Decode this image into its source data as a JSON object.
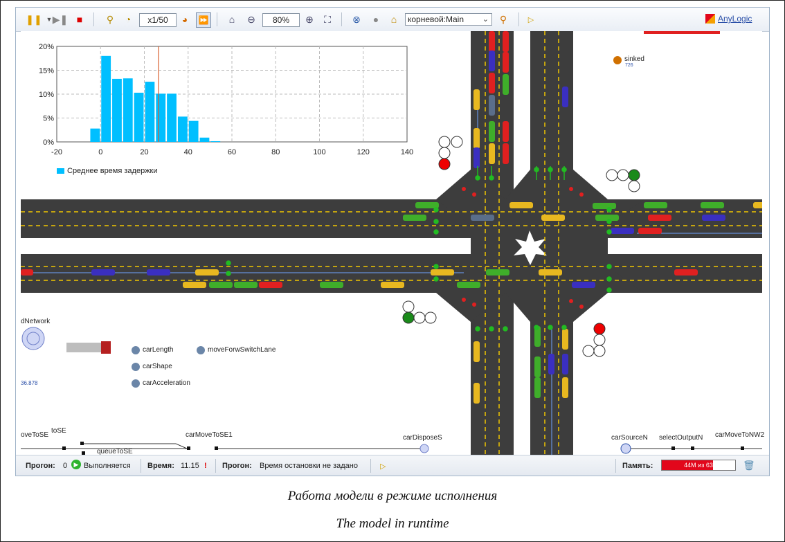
{
  "toolbar": {
    "speed": "x1/50",
    "zoom": "80%",
    "view_select": "корневой:Main",
    "logo": "AnyLogic"
  },
  "chart": {
    "legend": "Среднее время задержки"
  },
  "chart_data": {
    "type": "bar",
    "x": [
      -5,
      5,
      15,
      25,
      35,
      45,
      55,
      65,
      75
    ],
    "values": [
      2.8,
      18,
      13.2,
      13.3,
      10.3,
      12.6,
      10.1,
      10.1,
      5.3,
      4.4,
      0.9,
      0.15
    ],
    "bin_starts": [
      -5,
      0,
      5,
      10,
      15,
      20,
      25,
      30,
      35,
      40,
      45,
      50
    ],
    "xlim": [
      -20,
      140
    ],
    "ylim": [
      0,
      20
    ],
    "xticks": [
      "-20",
      "0",
      "20",
      "40",
      "60",
      "80",
      "100",
      "120",
      "140"
    ],
    "yticks": [
      "0%",
      "5%",
      "10%",
      "15%",
      "20%"
    ],
    "mean_line": 26.5,
    "series_name": "Среднее время задержки",
    "color": "#00bfff",
    "grid": true,
    "legend_position": "bottom-left"
  },
  "labels": {
    "sinked": "sinked",
    "sinked_value": "726",
    "network": "dNetwork",
    "network_value": "36.878",
    "func1": "carLength",
    "func2": "carShape",
    "func3": "carAcceleration",
    "func4": "moveForwSwitchLane",
    "flow1": "oveToSE",
    "flow2": "toSE",
    "flow3": "queueToSE",
    "flow4": "carMoveToSE1",
    "flow5": "carDisposeS",
    "flow6": "carSourceN",
    "flow7": "selectOutputN",
    "flow8": "carMoveToNW2"
  },
  "status": {
    "run_label": "Прогон:",
    "run_value": "0",
    "running": "Выполняется",
    "time_label": "Время:",
    "time_value": "11.15",
    "run2_label": "Прогон:",
    "stop_text": "Время остановки не задано",
    "memory_label": "Память:",
    "memory_value": "44M из 63",
    "memory_fraction": 0.7
  },
  "captions": {
    "ru": "Работа модели в режиме исполнения",
    "en": "The model in runtime"
  },
  "colors": {
    "road": "#3d3d3d",
    "lane_marking": "#f2c600",
    "bar": "#00bfff",
    "accent_red": "#e2071b"
  }
}
